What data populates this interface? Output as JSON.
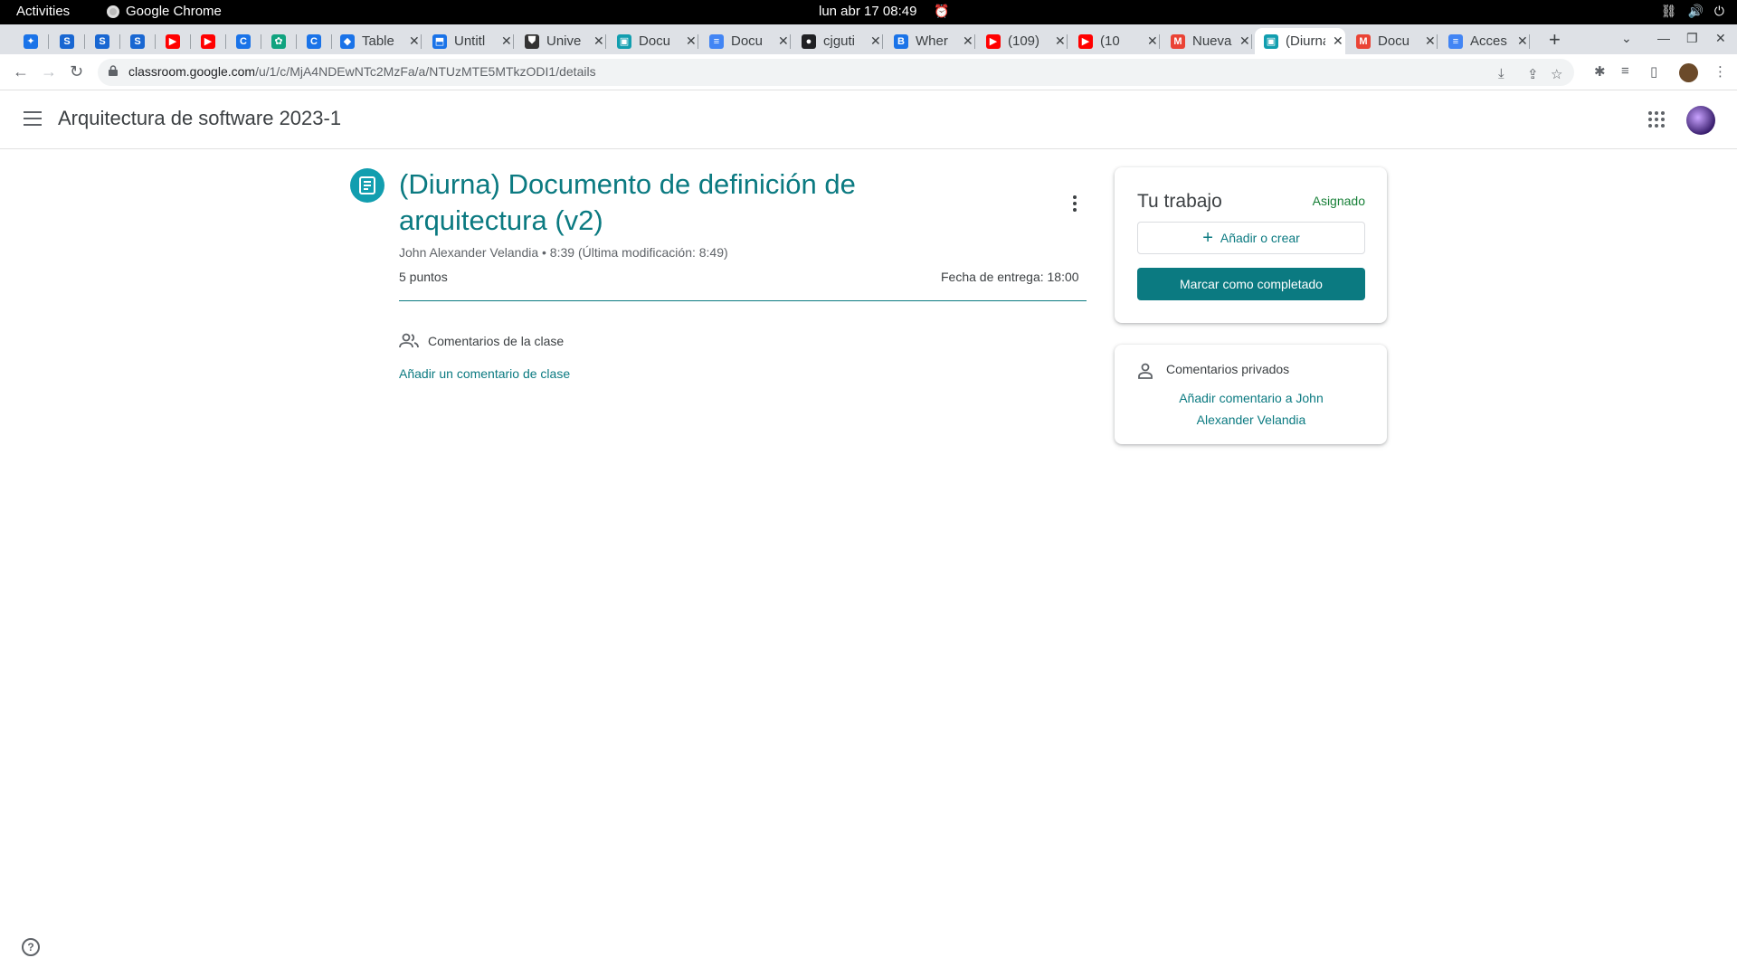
{
  "os_bar": {
    "activities": "Activities",
    "app_name": "Google Chrome",
    "clock": "lun abr 17  08:49"
  },
  "tabs": [
    {
      "title": "",
      "favicon": "bird-icon",
      "color": "#1a73e8"
    },
    {
      "title": "",
      "favicon": "s-icon",
      "color": "#1967d2"
    },
    {
      "title": "",
      "favicon": "s-icon",
      "color": "#1967d2"
    },
    {
      "title": "",
      "favicon": "s-icon",
      "color": "#1967d2"
    },
    {
      "title": "",
      "favicon": "youtube-icon",
      "color": "#ff0000"
    },
    {
      "title": "",
      "favicon": "youtube-icon",
      "color": "#ff0000"
    },
    {
      "title": "",
      "favicon": "c-icon",
      "color": "#1a73e8"
    },
    {
      "title": "",
      "favicon": "openai-icon",
      "color": "#10a37f"
    },
    {
      "title": "",
      "favicon": "c-icon",
      "color": "#1a73e8"
    },
    {
      "title": "Table",
      "favicon": "diamond-icon",
      "color": "#1a73e8"
    },
    {
      "title": "Untitl",
      "favicon": "drawio-icon",
      "color": "#1a73e8"
    },
    {
      "title": "Unive",
      "favicon": "shield-icon",
      "color": "#333333"
    },
    {
      "title": "Docu",
      "favicon": "classroom-icon",
      "color": "#129eaf"
    },
    {
      "title": "Docu",
      "favicon": "docs-icon",
      "color": "#4285f4"
    },
    {
      "title": "cjguti",
      "favicon": "github-icon",
      "color": "#202124"
    },
    {
      "title": "Wher",
      "favicon": "bookmark-icon",
      "color": "#1a73e8"
    },
    {
      "title": "(109)",
      "favicon": "youtube-icon",
      "color": "#ff0000"
    },
    {
      "title": "(10",
      "favicon": "youtube-icon",
      "color": "#ff0000"
    },
    {
      "title": "Nueva",
      "favicon": "gmail-icon",
      "color": "#ea4335"
    },
    {
      "title": "(Diurna",
      "favicon": "classroom-icon",
      "color": "#129eaf",
      "active": true
    },
    {
      "title": "Docu",
      "favicon": "gmail-icon",
      "color": "#ea4335"
    },
    {
      "title": "Acces",
      "favicon": "docs-icon",
      "color": "#4285f4"
    }
  ],
  "address": {
    "host": "classroom.google.com",
    "path": "/u/1/c/MjA4NDEwNTc2MzFa/a/NTUzMTE5MTkzODI1/details"
  },
  "classroom": {
    "course_title": "Arquitectura de software 2023-1"
  },
  "assignment": {
    "title": "(Diurna) Documento de definición de arquitectura (v2)",
    "meta": "John Alexander Velandia • 8:39 (Última modificación: 8:49)",
    "points": "5 puntos",
    "due": "Fecha de entrega: 18:00",
    "class_comments_label": "Comentarios de la clase",
    "add_class_comment": "Añadir un comentario de clase"
  },
  "work_card": {
    "title": "Tu trabajo",
    "status": "Asignado",
    "add_label": "Añadir o crear",
    "done_label": "Marcar como completado"
  },
  "private_card": {
    "label": "Comentarios privados",
    "add_link": "Añadir comentario a John Alexander Velandia"
  },
  "colors": {
    "accent": "#0b7a81",
    "status_green": "#188038",
    "assignment_icon_bg": "#129eaf"
  }
}
